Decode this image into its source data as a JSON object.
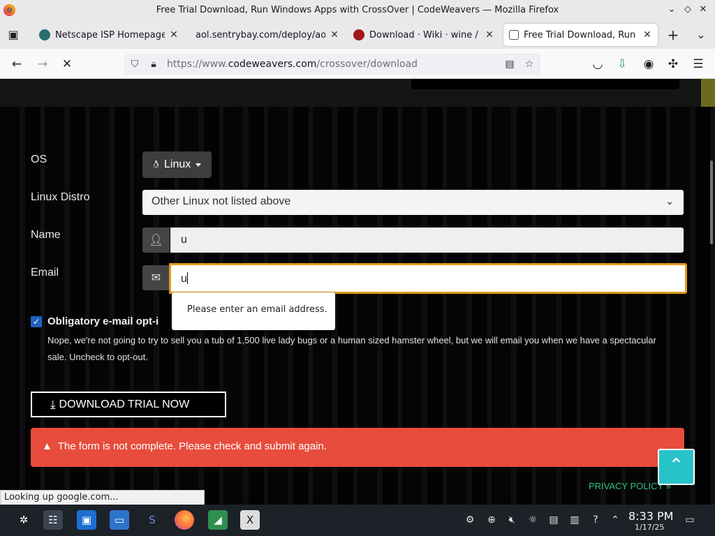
{
  "window": {
    "title": "Free Trial Download, Run Windows Apps with CrossOver | CodeWeavers — Mozilla Firefox"
  },
  "tabs": [
    {
      "label": "Netscape ISP Homepage",
      "active": false,
      "favicon_color": "#2a6d6d"
    },
    {
      "label": "aol.sentrybay.com/deploy/aol.",
      "active": false,
      "favicon_color": ""
    },
    {
      "label": "Download · Wiki · wine / wi",
      "active": false,
      "favicon_color": "#a3161c"
    },
    {
      "label": "Free Trial Download, Run W",
      "active": true,
      "favicon_color": "#555555"
    }
  ],
  "navbar": {
    "url_prefix": "https://www.",
    "url_domain": "codeweavers.com",
    "url_path": "/crossover/download"
  },
  "form": {
    "os_label": "OS",
    "os_value": "Linux",
    "distro_label": "Linux Distro",
    "distro_value": "Other Linux not listed above",
    "name_label": "Name",
    "name_value": "u",
    "email_label": "Email",
    "email_value": "u",
    "email_tooltip": "Please enter an email address.",
    "optin_checked": true,
    "optin_label": "Obligatory e-mail opt-i",
    "optin_description": "Nope, we're not going to try to sell you a tub of 1,500 live lady bugs or a human sized hamster wheel, but we will email you when we have a spectacular sale. Uncheck to opt-out.",
    "download_label": "DOWNLOAD TRIAL NOW",
    "alert_text": "The form is not complete. Please check and submit again."
  },
  "footer": {
    "privacy_label": "PRIVACY POLICY"
  },
  "status": {
    "text": "Looking up google.com..."
  },
  "taskbar": {
    "time": "8:33 PM",
    "date": "1/17/25"
  },
  "colors": {
    "accent_focus": "#e09b1c",
    "alert_red": "#e74c3c",
    "scroll_top_teal": "#27c3c8",
    "privacy_green": "#2ec27e",
    "checkbox_blue": "#1f61c1"
  }
}
